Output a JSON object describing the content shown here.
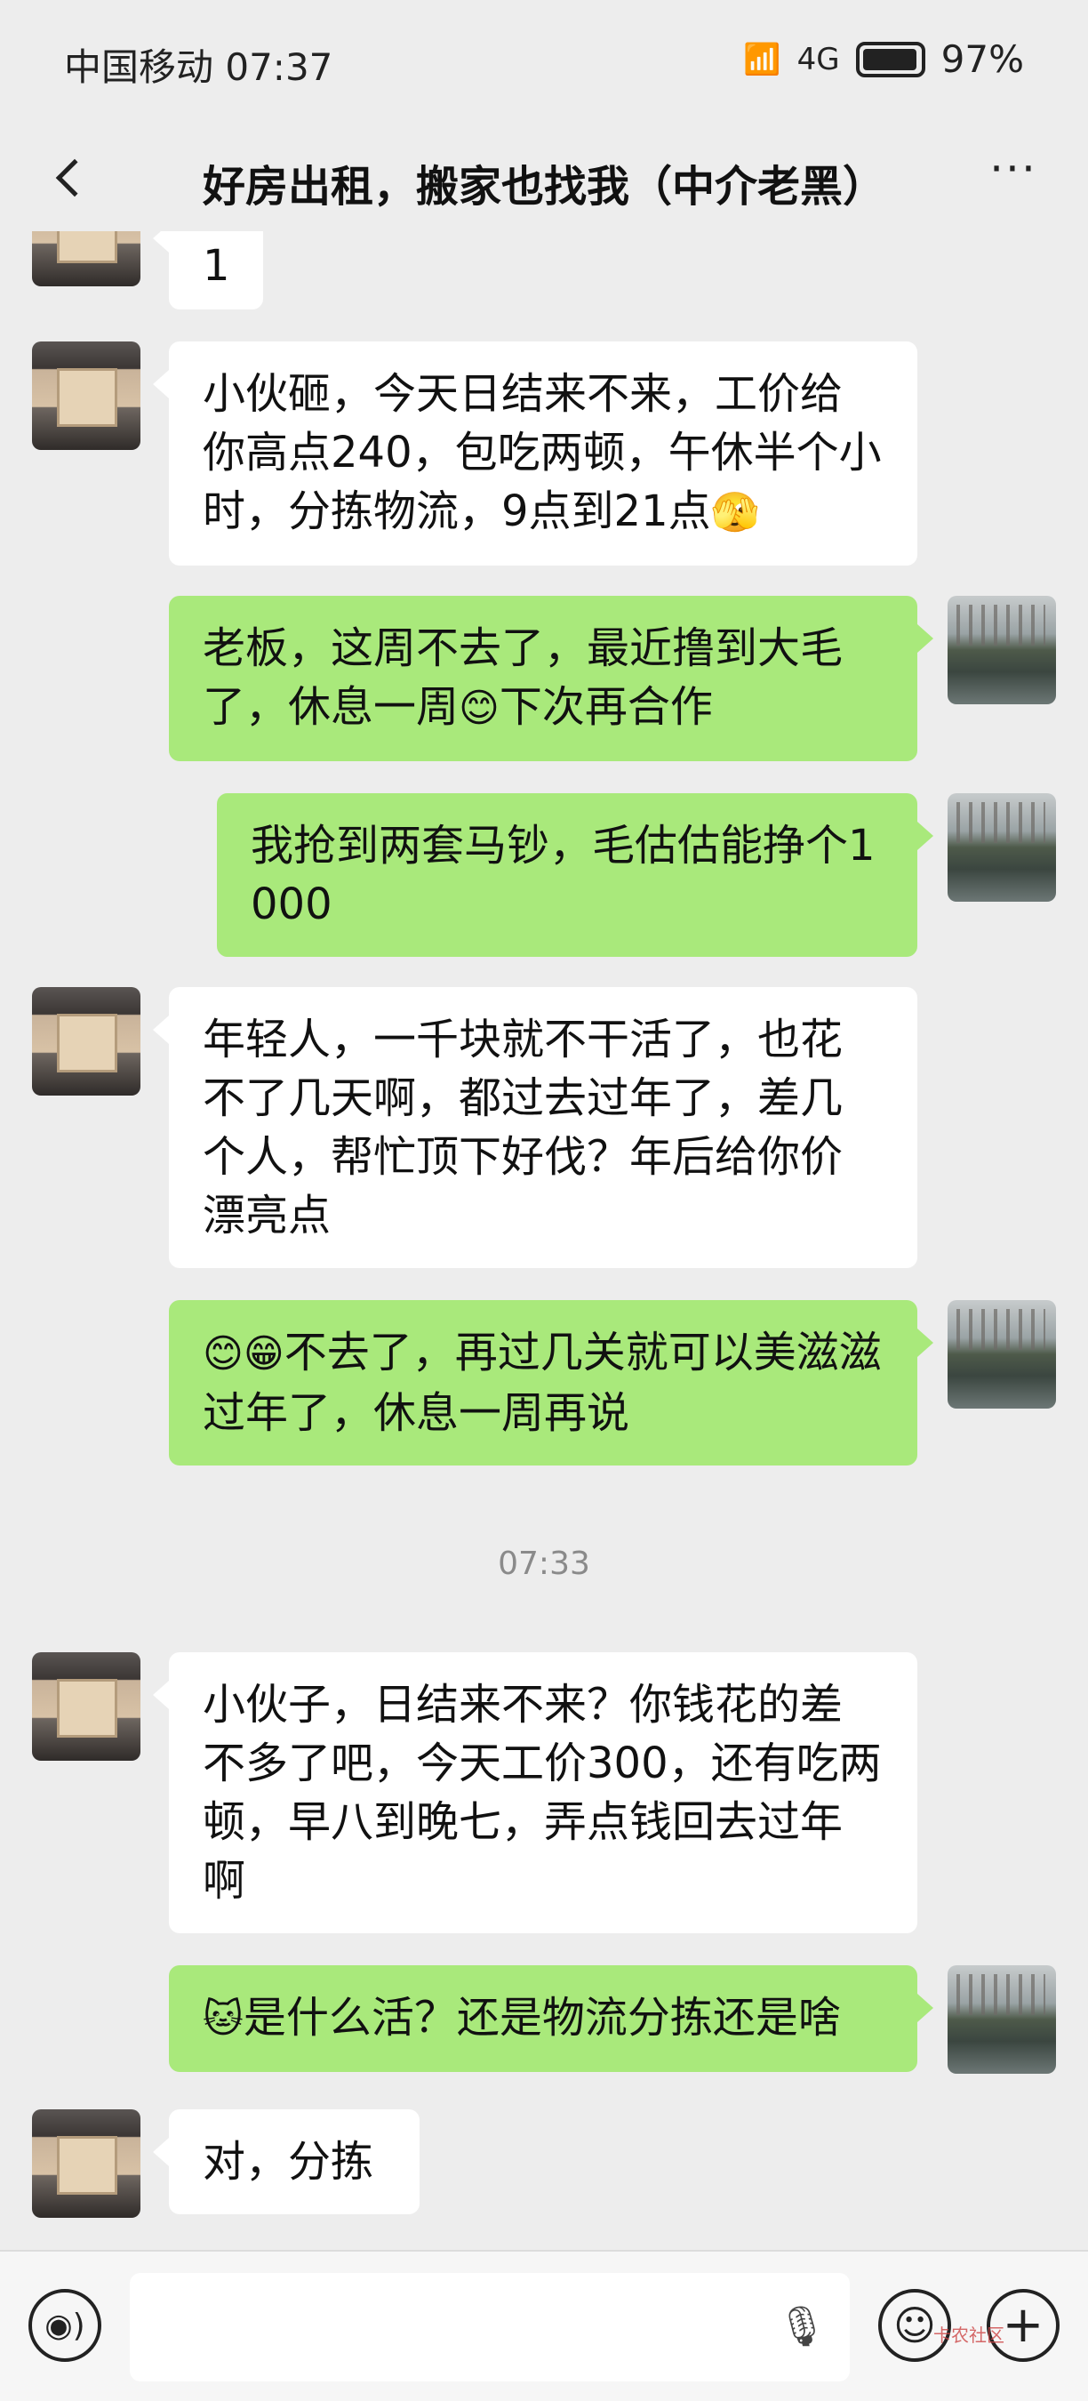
{
  "status_bar": {
    "carrier_time": "中国移动 07:37",
    "network": "4G",
    "battery": "97%"
  },
  "header": {
    "title": "好房出租，搬家也找我（中介老黑）"
  },
  "messages": [
    {
      "side": "left",
      "text": "1"
    },
    {
      "side": "left",
      "text": "小伙砸，今天日结来不来，工价给你高点240，包吃两顿，午休半个小时，分拣物流，9点到21点",
      "emoji": "🫣"
    },
    {
      "side": "right",
      "text_a": "老板，这周不去了，最近撸到大毛了，休息一周",
      "emoji": "😊",
      "text_b": "下次再合作"
    },
    {
      "side": "right",
      "text": "我抢到两套马钞，毛估估能挣个1000"
    },
    {
      "side": "left",
      "text": "年轻人，一千块就不干活了，也花不了几天啊，都过去过年了，差几个人，帮忙顶下好伐？年后给你价漂亮点"
    },
    {
      "side": "right",
      "emoji": "😊😁",
      "text": "不去了，再过几关就可以美滋滋过年了，休息一周再说"
    },
    {
      "side": "left",
      "text": "小伙子，日结来不来？你钱花的差不多了吧，今天工价300，还有吃两顿，早八到晚七，弄点钱回去过年啊"
    },
    {
      "side": "right",
      "emoji": "🐱",
      "text": "是什么活？还是物流分拣还是啥"
    },
    {
      "side": "left",
      "text": "对，分拣"
    }
  ],
  "timestamp": "07:33",
  "watermark": "卡农社区"
}
